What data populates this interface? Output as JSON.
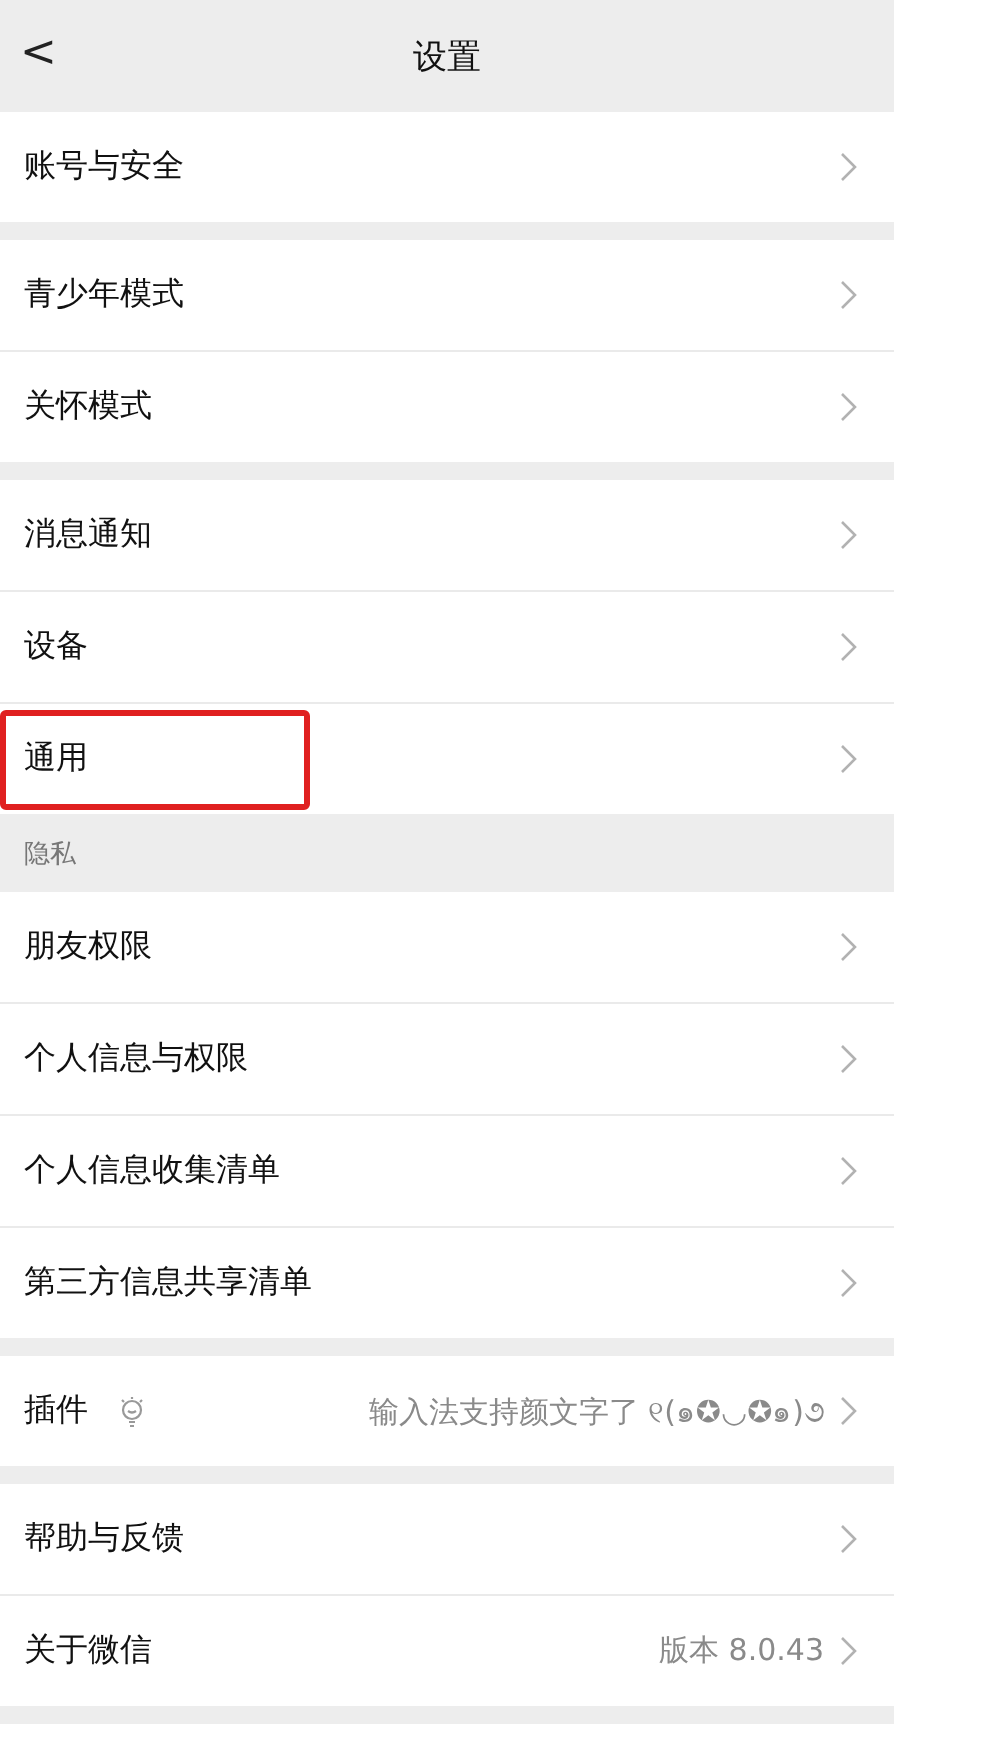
{
  "header": {
    "back": "<",
    "title": "设置"
  },
  "groups": [
    {
      "items": [
        {
          "label": "账号与安全",
          "highlighted": false
        }
      ]
    },
    {
      "items": [
        {
          "label": "青少年模式",
          "highlighted": false
        },
        {
          "label": "关怀模式",
          "highlighted": false
        }
      ]
    },
    {
      "items": [
        {
          "label": "消息通知",
          "highlighted": false
        },
        {
          "label": "设备",
          "highlighted": false
        },
        {
          "label": "通用",
          "highlighted": true
        }
      ]
    },
    {
      "header": "隐私",
      "items": [
        {
          "label": "朋友权限",
          "highlighted": false
        },
        {
          "label": "个人信息与权限",
          "highlighted": false
        },
        {
          "label": "个人信息收集清单",
          "highlighted": false
        },
        {
          "label": "第三方信息共享清单",
          "highlighted": false
        }
      ]
    },
    {
      "items": [
        {
          "label": "插件",
          "icon": true,
          "value": "输入法支持颜文字了 ୧(๑✪◡✪๑)૭",
          "highlighted": false
        }
      ]
    },
    {
      "items": [
        {
          "label": "帮助与反馈",
          "highlighted": false
        },
        {
          "label": "关于微信",
          "value": "版本 8.0.43",
          "highlighted": false
        }
      ]
    }
  ]
}
